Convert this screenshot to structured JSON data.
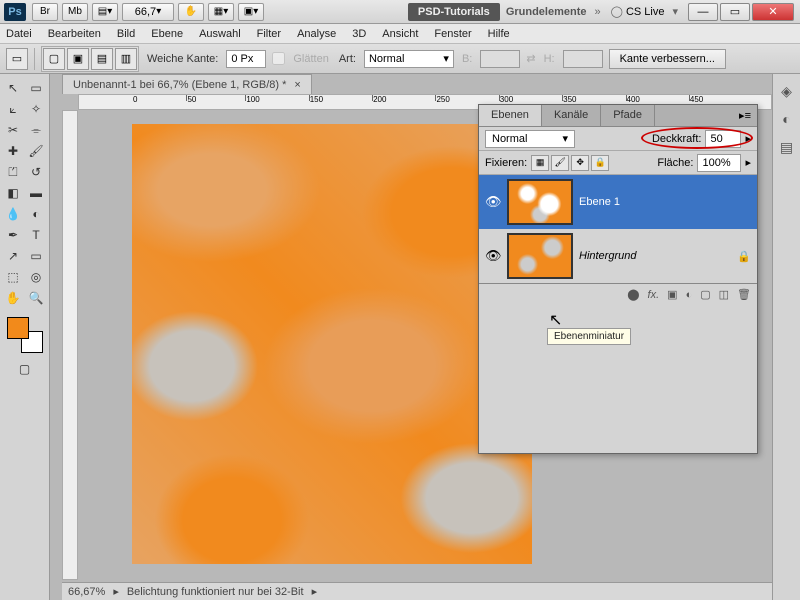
{
  "title": {
    "psd_tutorials": "PSD-Tutorials",
    "grundelemente": "Grundelemente",
    "cs_live": "CS Live",
    "zoom_combo": "66,7"
  },
  "menu": {
    "datei": "Datei",
    "bearbeiten": "Bearbeiten",
    "bild": "Bild",
    "ebene": "Ebene",
    "auswahl": "Auswahl",
    "filter": "Filter",
    "analyse": "Analyse",
    "d3": "3D",
    "ansicht": "Ansicht",
    "fenster": "Fenster",
    "hilfe": "Hilfe"
  },
  "options": {
    "weiche_kante_lbl": "Weiche Kante:",
    "weiche_kante_val": "0 Px",
    "glatten": "Glätten",
    "art_lbl": "Art:",
    "art_val": "Normal",
    "b_lbl": "B:",
    "h_lbl": "H:",
    "kante_btn": "Kante verbessern..."
  },
  "doc": {
    "tab": "Unbenannt-1 bei 66,7% (Ebene 1, RGB/8) *",
    "status_zoom": "66,67%",
    "status_msg": "Belichtung funktioniert nur bei 32-Bit"
  },
  "panel": {
    "tabs": {
      "ebenen": "Ebenen",
      "kanaele": "Kanäle",
      "pfade": "Pfade"
    },
    "mode": "Normal",
    "deckkraft_lbl": "Deckkraft:",
    "deckkraft_val": "50",
    "fixieren_lbl": "Fixieren:",
    "flaeche_lbl": "Fläche:",
    "flaeche_val": "100%",
    "layers": [
      {
        "name": "Ebene 1",
        "visible": true,
        "selected": true
      },
      {
        "name": "Hintergrund",
        "visible": true,
        "locked": true
      }
    ],
    "tooltip": "Ebenenminiatur"
  },
  "win": {
    "min": "—",
    "max": "▭",
    "close": "✕"
  }
}
